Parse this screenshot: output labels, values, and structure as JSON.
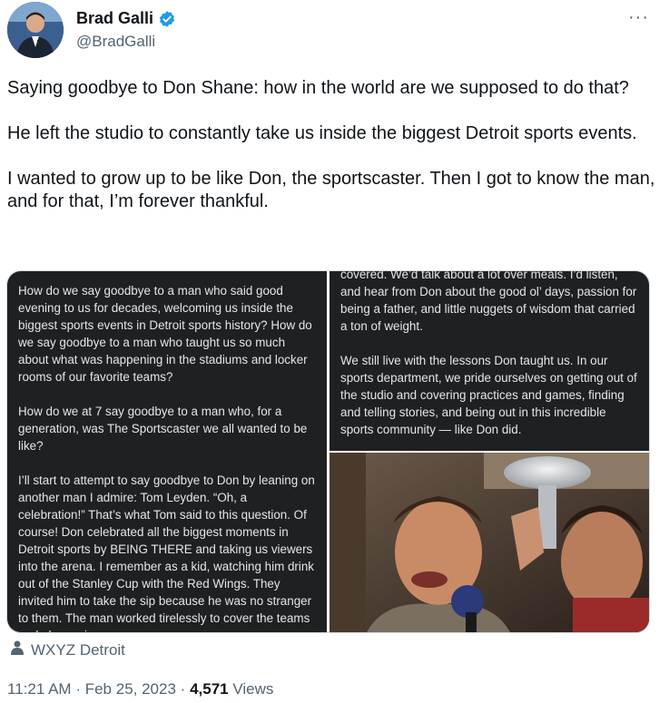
{
  "author": {
    "name": "Brad Galli",
    "handle": "@BradGalli",
    "verified_color": "#1d9bf0"
  },
  "more_label": "···",
  "tweet_paragraphs": [
    "Saying goodbye to Don Shane: how in the world are we supposed to do that?",
    "He left the studio to constantly take us inside the biggest Detroit sports events.",
    "I wanted to grow up to be like Don, the sportscaster. Then I got to know the man, and for that, I’m forever thankful."
  ],
  "media": {
    "left_paragraphs": [
      "How do we say goodbye to a man who said good evening to us for decades, welcoming us inside the biggest sports events in Detroit sports history? How do we say goodbye to a man who taught us so much about what was happening in the stadiums and locker rooms of our favorite teams?",
      "How do we at 7 say goodbye to a man who, for a generation, was The Sportscaster we all wanted to be like?",
      "I’ll start to attempt to say goodbye to Don by leaning on another man I admire: Tom Leyden. “Oh, a celebration!” That’s what Tom said to this question. Of course! Don celebrated all the biggest moments in Detroit sports by BEING THERE and taking us viewers into the arena. I remember as a kid, watching him drink out of the Stanley Cup with the Red Wings. They invited him to take the sip because he was no stranger to them. The man worked tirelessly to cover the teams and players in"
    ],
    "right_paragraphs": [
      "covered. We’d talk about a lot over meals. I’d listen, and hear from Don about the good ol’ days, passion for being a father, and little nuggets of wisdom that carried a ton of weight.",
      "We still live with the lessons Don taught us. In our sports department, we pride ourselves on getting out of the studio and covering practices and games, finding and telling stories, and being out in this incredible sports community — like Don did."
    ]
  },
  "source_label": "WXYZ Detroit",
  "meta": {
    "time": "11:21 AM",
    "separator": "·",
    "date": "Feb 25, 2023",
    "views_count": "4,571",
    "views_label": "Views"
  }
}
